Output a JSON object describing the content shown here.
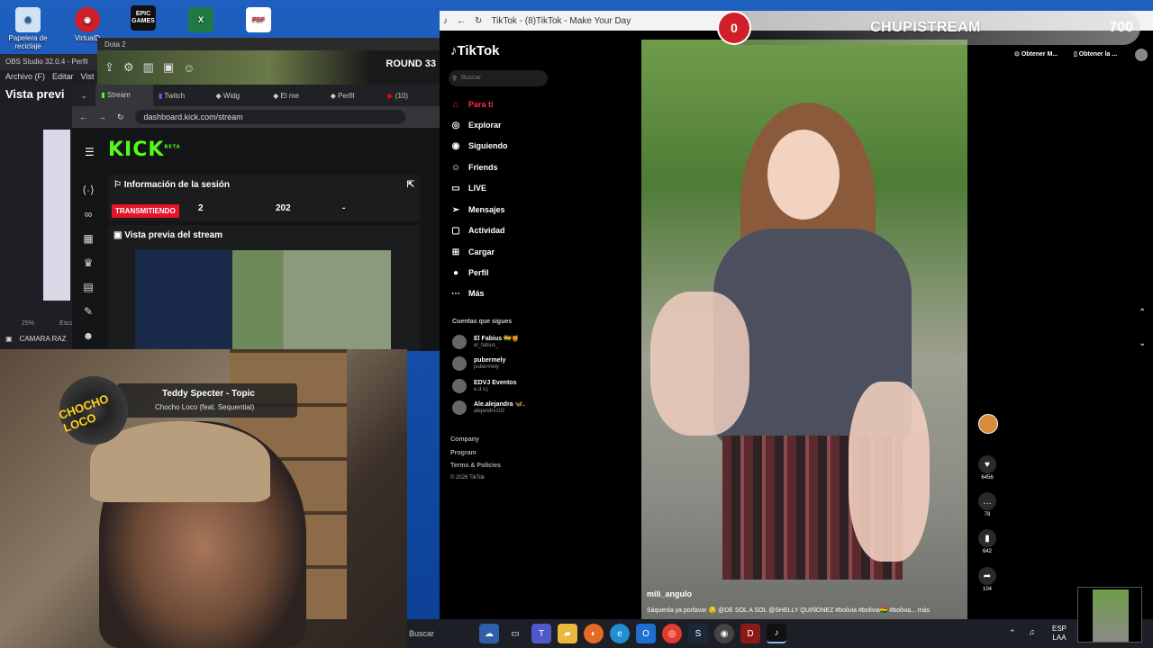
{
  "desktop": {
    "icons": [
      {
        "label": "Papelera de reciclaje",
        "icon": "recycle-bin-icon"
      },
      {
        "label": "VirtualD",
        "icon": "virtual-desktop-icon"
      },
      {
        "label": "EPIC GAMES",
        "icon": "epic-games-icon"
      },
      {
        "label": "",
        "icon": "excel-icon"
      },
      {
        "label": "PDF",
        "icon": "pdf-icon"
      }
    ]
  },
  "obs": {
    "title": "OBS Studio 32.0.4 - Perfil",
    "menu": [
      "Archivo (F)",
      "Editar",
      "Vist"
    ],
    "preview_label": "Vista previ",
    "zoom": "25%",
    "scale_label": "Esca",
    "source_label": "CAMARA RAZ"
  },
  "dota": {
    "title": "Dota 2",
    "round": "ROUND 33"
  },
  "kick": {
    "tabs": [
      "Stream",
      "Twitch",
      "Widg",
      "El me",
      "Perfil",
      "(10)"
    ],
    "url": "dashboard.kick.com/stream",
    "logo": "KICK",
    "logo_sup": "BETA",
    "session": {
      "title": "Información de la sesión",
      "status": "TRANSMITIENDO",
      "viewers": "2",
      "followers": "202",
      "dash": "-"
    },
    "preview_title": "Vista previa del stream"
  },
  "music": {
    "disc_text": "CHOCHO LOCO",
    "title": "Teddy Specter - Topic",
    "subtitle": "Chocho Loco (feat. Sequential)"
  },
  "tiktok": {
    "window_title": "TikTok - (8)TikTok - Make Your Day",
    "logo": "TikTok",
    "search_placeholder": "Buscar",
    "nav": [
      {
        "label": "Para ti",
        "icon": "home-icon",
        "active": true
      },
      {
        "label": "Explorar",
        "icon": "compass-icon"
      },
      {
        "label": "Siguiendo",
        "icon": "following-icon"
      },
      {
        "label": "Friends",
        "icon": "friends-icon"
      },
      {
        "label": "LIVE",
        "icon": "live-icon"
      },
      {
        "label": "Mensajes",
        "icon": "message-icon"
      },
      {
        "label": "Actividad",
        "icon": "activity-icon"
      },
      {
        "label": "Cargar",
        "icon": "upload-icon"
      },
      {
        "label": "Perfil",
        "icon": "profile-icon"
      },
      {
        "label": "Más",
        "icon": "more-icon"
      }
    ],
    "following_header": "Cuentas que sigues",
    "following": [
      {
        "name": "El Fabius 🇧🇴🍯",
        "user": "el_fabius_"
      },
      {
        "name": "pubermely",
        "user": "pubermely"
      },
      {
        "name": "EDVJ Eventos",
        "user": "e.d.v.j"
      },
      {
        "name": "Ale.alejandra 🦋.",
        "user": "alejandrx102"
      }
    ],
    "footer": [
      "Company",
      "Program",
      "Terms & Policies",
      "© 2026 TikTok"
    ],
    "top_links": [
      "Obtener M...",
      "Obtener la ..."
    ],
    "video": {
      "username": "mili_angulo",
      "description": "Sáquenla ya porfavor 😏 @DE SOL A SOL @SHELLY QUIÑONEZ #bolivia #bolivia🇧🇴 #bolivia...  más"
    },
    "actions": [
      {
        "icon": "heart-icon",
        "count": "6456"
      },
      {
        "icon": "comment-icon",
        "count": "78"
      },
      {
        "icon": "bookmark-icon",
        "count": "642"
      },
      {
        "icon": "share-icon",
        "count": "104"
      }
    ]
  },
  "overlay": {
    "count": "0",
    "name": "CHUPISTREAM",
    "points": "700"
  },
  "taskbar": {
    "search": "Buscar",
    "lang_top": "ESP",
    "lang_bottom": "LAA"
  }
}
